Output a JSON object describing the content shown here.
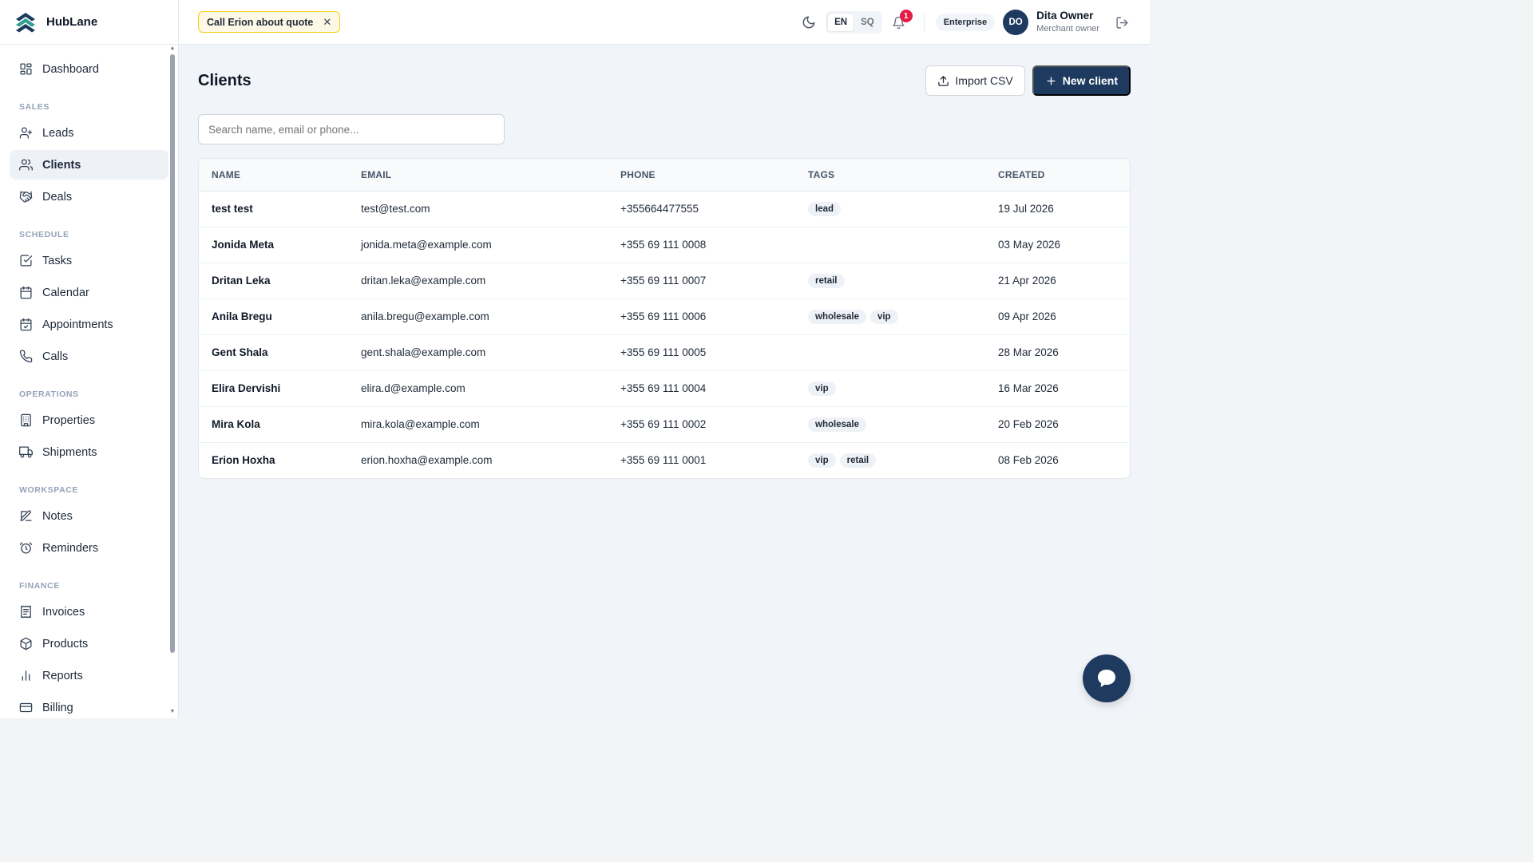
{
  "brand": {
    "name": "HubLane"
  },
  "sidebar": {
    "items": [
      {
        "label": "Dashboard",
        "icon": "dashboard-icon",
        "active": false
      },
      {
        "section": "SALES"
      },
      {
        "label": "Leads",
        "icon": "user-plus-icon",
        "active": false
      },
      {
        "label": "Clients",
        "icon": "users-icon",
        "active": true
      },
      {
        "label": "Deals",
        "icon": "handshake-icon",
        "active": false
      },
      {
        "section": "SCHEDULE"
      },
      {
        "label": "Tasks",
        "icon": "checkbox-icon",
        "active": false
      },
      {
        "label": "Calendar",
        "icon": "calendar-icon",
        "active": false
      },
      {
        "label": "Appointments",
        "icon": "calendar-check-icon",
        "active": false
      },
      {
        "label": "Calls",
        "icon": "phone-icon",
        "active": false
      },
      {
        "section": "OPERATIONS"
      },
      {
        "label": "Properties",
        "icon": "building-icon",
        "active": false
      },
      {
        "label": "Shipments",
        "icon": "truck-icon",
        "active": false
      },
      {
        "section": "WORKSPACE"
      },
      {
        "label": "Notes",
        "icon": "note-icon",
        "active": false
      },
      {
        "label": "Reminders",
        "icon": "alarm-icon",
        "active": false
      },
      {
        "section": "FINANCE"
      },
      {
        "label": "Invoices",
        "icon": "invoice-icon",
        "active": false
      },
      {
        "label": "Products",
        "icon": "box-icon",
        "active": false
      },
      {
        "label": "Reports",
        "icon": "bar-chart-icon",
        "active": false
      },
      {
        "label": "Billing",
        "icon": "credit-card-icon",
        "active": false
      }
    ]
  },
  "topbar": {
    "reminder": "Call Erion about quote",
    "languages": [
      "EN",
      "SQ"
    ],
    "active_language": "EN",
    "notification_count": "1",
    "plan": "Enterprise",
    "user": {
      "initials": "DO",
      "name": "Dita Owner",
      "role": "Merchant owner"
    }
  },
  "page": {
    "title": "Clients",
    "import_label": "Import CSV",
    "new_label": "New client",
    "search_placeholder": "Search name, email or phone..."
  },
  "table": {
    "columns": [
      "NAME",
      "EMAIL",
      "PHONE",
      "TAGS",
      "CREATED"
    ],
    "rows": [
      {
        "name": "test test",
        "email": "test@test.com",
        "phone": "+355664477555",
        "tags": [
          "lead"
        ],
        "created": "19 Jul 2026"
      },
      {
        "name": "Jonida Meta",
        "email": "jonida.meta@example.com",
        "phone": "+355 69 111 0008",
        "tags": [],
        "created": "03 May 2026"
      },
      {
        "name": "Dritan Leka",
        "email": "dritan.leka@example.com",
        "phone": "+355 69 111 0007",
        "tags": [
          "retail"
        ],
        "created": "21 Apr 2026"
      },
      {
        "name": "Anila Bregu",
        "email": "anila.bregu@example.com",
        "phone": "+355 69 111 0006",
        "tags": [
          "wholesale",
          "vip"
        ],
        "created": "09 Apr 2026"
      },
      {
        "name": "Gent Shala",
        "email": "gent.shala@example.com",
        "phone": "+355 69 111 0005",
        "tags": [],
        "created": "28 Mar 2026"
      },
      {
        "name": "Elira Dervishi",
        "email": "elira.d@example.com",
        "phone": "+355 69 111 0004",
        "tags": [
          "vip"
        ],
        "created": "16 Mar 2026"
      },
      {
        "name": "Mira Kola",
        "email": "mira.kola@example.com",
        "phone": "+355 69 111 0002",
        "tags": [
          "wholesale"
        ],
        "created": "20 Feb 2026"
      },
      {
        "name": "Erion Hoxha",
        "email": "erion.hoxha@example.com",
        "phone": "+355 69 111 0001",
        "tags": [
          "vip",
          "retail"
        ],
        "created": "08 Feb 2026"
      }
    ]
  },
  "colors": {
    "primary": "#1e3a5f",
    "badge": "#e11d48",
    "reminder_bg": "#fef9e7",
    "reminder_border": "#facc15"
  }
}
